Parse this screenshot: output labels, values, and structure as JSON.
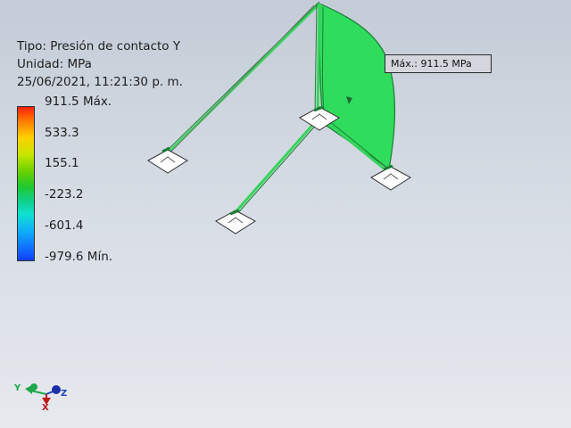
{
  "info": {
    "tipo": "Tipo: Presión de contacto Y",
    "unidad": "Unidad: MPa",
    "fecha": "25/06/2021, 11:21:30 p. m."
  },
  "legend": {
    "labels": [
      "911.5 Máx.",
      "533.3",
      "155.1",
      "-223.2",
      "-601.4",
      "-979.6 Mín."
    ]
  },
  "max_probe": {
    "label": "Máx.: 911.5 MPa"
  },
  "triad": {
    "x": "X",
    "y": "Y",
    "z": "Z"
  },
  "colors": {
    "mesh_green": "#2fdc5c",
    "mesh_edge": "#1b7d35",
    "background_top": "#c3ccd7",
    "background_bottom": "#e6e9ee"
  }
}
